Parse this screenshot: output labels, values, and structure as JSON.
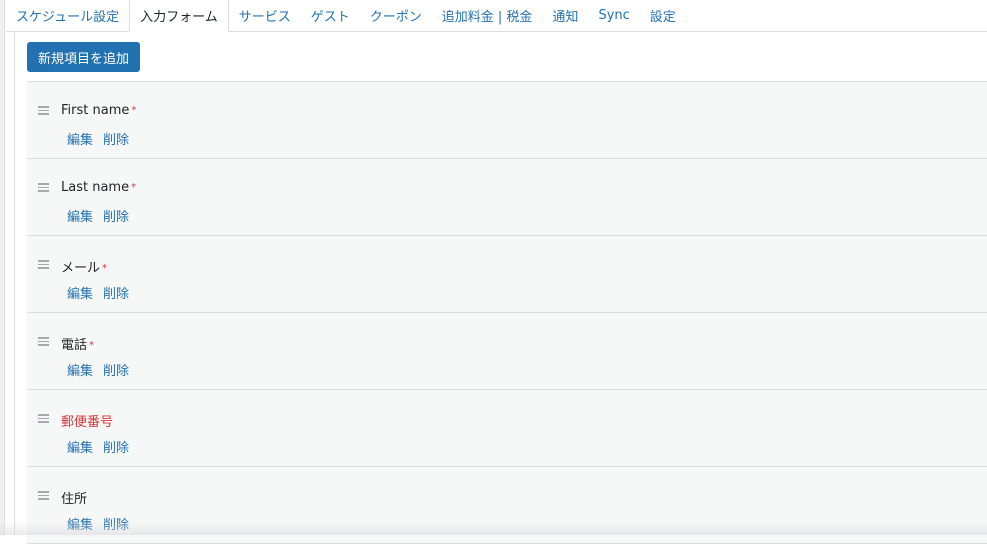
{
  "tabs": [
    {
      "label": "スケジュール設定",
      "active": false
    },
    {
      "label": "入力フォーム",
      "active": true
    },
    {
      "label": "サービス",
      "active": false
    },
    {
      "label": "ゲスト",
      "active": false
    },
    {
      "label": "クーポン",
      "active": false
    },
    {
      "label": "追加料金 | 税金",
      "active": false
    },
    {
      "label": "通知",
      "active": false
    },
    {
      "label": "Sync",
      "active": false
    },
    {
      "label": "設定",
      "active": false
    }
  ],
  "add_button_label": "新規項目を追加",
  "fields": [
    {
      "label": "First name",
      "required": true,
      "error": false
    },
    {
      "label": "Last name",
      "required": true,
      "error": false
    },
    {
      "label": "メール",
      "required": true,
      "error": false
    },
    {
      "label": "電話",
      "required": true,
      "error": false
    },
    {
      "label": "郵便番号",
      "required": false,
      "error": true
    },
    {
      "label": "住所",
      "required": false,
      "error": false
    }
  ],
  "actions": {
    "edit": "編集",
    "delete": "削除"
  },
  "required_mark": "*",
  "colors": {
    "link": "#2271b1",
    "primary_button": "#2271b1",
    "error": "#d63638",
    "row_bg": "#f6f7f7"
  }
}
